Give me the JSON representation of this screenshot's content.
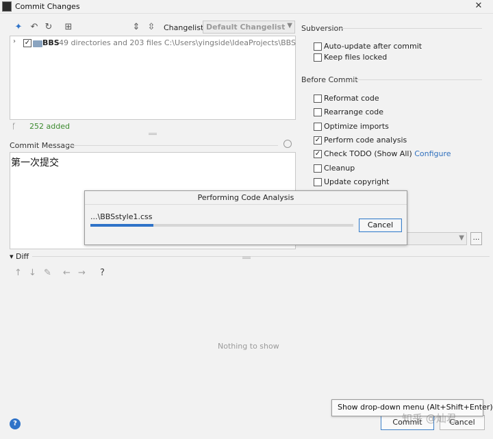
{
  "window": {
    "title": "Commit Changes",
    "close_glyph": "✕"
  },
  "toolbar": {
    "icons": [
      "refresh-spark-icon",
      "undo-icon",
      "sync-icon",
      "group-by-icon",
      "expand-all-icon",
      "collapse-all-icon"
    ],
    "changelist_label": "Changelist:",
    "changelist_value": "Default Changelist"
  },
  "tree": {
    "root_label": "BBS",
    "root_checked": true,
    "root_details": "49 directories and 203 files  C:\\Users\\yingside\\IdeaProjects\\BBS",
    "status": "252 added"
  },
  "commit_message": {
    "label": "Commit Message",
    "text": "第一次提交"
  },
  "subversion": {
    "title": "Subversion",
    "options": [
      {
        "label": "Auto-update after commit",
        "checked": false
      },
      {
        "label": "Keep files locked",
        "checked": false
      }
    ]
  },
  "before_commit": {
    "title": "Before Commit",
    "options": [
      {
        "label": "Reformat code",
        "checked": false
      },
      {
        "label": "Rearrange code",
        "checked": false
      },
      {
        "label": "Optimize imports",
        "checked": false
      },
      {
        "label": "Perform code analysis",
        "checked": true
      },
      {
        "label": "Check TODO (Show All)",
        "link": "Configure",
        "checked": true
      },
      {
        "label": "Cleanup",
        "checked": false
      },
      {
        "label": "Update copyright",
        "checked": false
      }
    ]
  },
  "diff": {
    "label": "Diff",
    "empty_text": "Nothing to show",
    "help_glyph": "?"
  },
  "progress_dialog": {
    "title": "Performing Code Analysis",
    "current_file": "...\\BBSstyle1.css",
    "progress_fraction": 0.24,
    "cancel_label": "Cancel"
  },
  "footer": {
    "help_glyph": "?",
    "commit_label": "Commit",
    "cancel_label": "Cancel",
    "tooltip": "Show drop-down menu (Alt+Shift+Enter)",
    "watermark": "知乎 @灿君"
  },
  "colors": {
    "accent": "#2f73c8",
    "added_green": "#3b8a2e",
    "link_blue": "#2f6fbd"
  }
}
